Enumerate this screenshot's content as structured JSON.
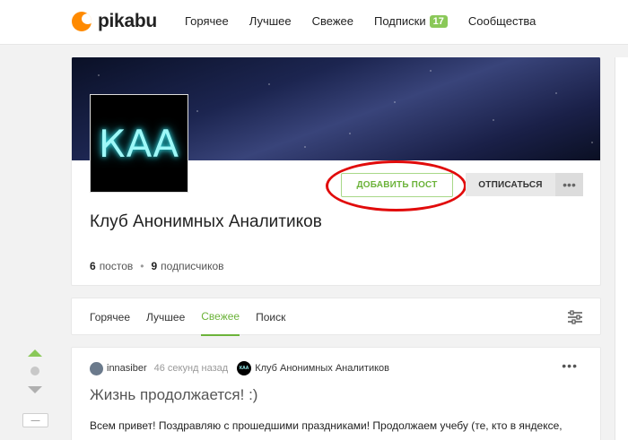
{
  "header": {
    "logo_text": "pikabu",
    "nav": [
      {
        "label": "Горячее"
      },
      {
        "label": "Лучшее"
      },
      {
        "label": "Свежее"
      },
      {
        "label": "Подписки",
        "badge": "17"
      },
      {
        "label": "Сообщества"
      }
    ]
  },
  "community": {
    "avatar_text": "КАА",
    "title": "Клуб Анонимных Аналитиков",
    "add_post_label": "ДОБАВИТЬ ПОСТ",
    "unsubscribe_label": "ОТПИСАТЬСЯ",
    "more_label": "•••",
    "posts_count": "6",
    "posts_label": "постов",
    "subscribers_count": "9",
    "subscribers_label": "подписчиков"
  },
  "tabs": [
    {
      "label": "Горячее",
      "active": false
    },
    {
      "label": "Лучшее",
      "active": false
    },
    {
      "label": "Свежее",
      "active": true
    },
    {
      "label": "Поиск",
      "active": false
    }
  ],
  "post": {
    "author": "innasiber",
    "time": "46 секунд назад",
    "community_avatar": "КАА",
    "community": "Клуб Анонимных Аналитиков",
    "more": "•••",
    "title": "Жизнь продолжается! :)",
    "text": "Всем привет! Поздравляю с прошедшими праздниками! Продолжаем учебу (те, кто в яндексе,"
  },
  "sidebar": {
    "collapse_label": "—"
  },
  "colors": {
    "accent_green": "#6cb33a",
    "logo_orange": "#ff8a00",
    "highlight_red": "#e10b0b",
    "badge_green": "#8ac858"
  }
}
